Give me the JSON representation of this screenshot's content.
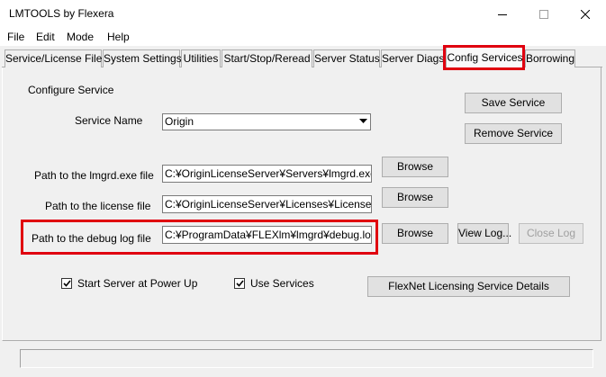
{
  "window": {
    "title": "LMTOOLS by Flexera",
    "controls": {
      "minimize": "minimize-icon",
      "maximize": "maximize-icon",
      "close": "close-icon"
    }
  },
  "menu": {
    "items": [
      "File",
      "Edit",
      "Mode",
      "Help"
    ]
  },
  "tabs": [
    {
      "label": "Service/License File"
    },
    {
      "label": "System Settings"
    },
    {
      "label": "Utilities"
    },
    {
      "label": "Start/Stop/Reread"
    },
    {
      "label": "Server Status"
    },
    {
      "label": "Server Diags"
    },
    {
      "label": "Config Services",
      "active": true,
      "highlighted": true
    },
    {
      "label": "Borrowing"
    }
  ],
  "config": {
    "section_title": "Configure Service",
    "service_name_label": "Service Name",
    "service_name_value": "Origin",
    "save_service": "Save Service",
    "remove_service": "Remove Service",
    "lmgrd_label": "Path to the lmgrd.exe file",
    "lmgrd_value": "C:¥OriginLicenseServer¥Servers¥lmgrd.exe",
    "license_label": "Path to the license file",
    "license_value": "C:¥OriginLicenseServer¥Licenses¥License.lic",
    "debug_label": "Path to the debug log file",
    "debug_value": "C:¥ProgramData¥FLEXlm¥lmgrd¥debug.log",
    "browse": "Browse",
    "view_log": "View Log...",
    "close_log": "Close Log",
    "start_at_power_up": {
      "label": "Start Server at Power Up",
      "checked": true
    },
    "use_services": {
      "label": "Use Services",
      "checked": true
    },
    "flexnet_details": "FlexNet Licensing Service Details"
  },
  "colors": {
    "highlight": "#e0000f",
    "window_bg": "#f0f0f0"
  },
  "status_bar": {
    "text": ""
  }
}
